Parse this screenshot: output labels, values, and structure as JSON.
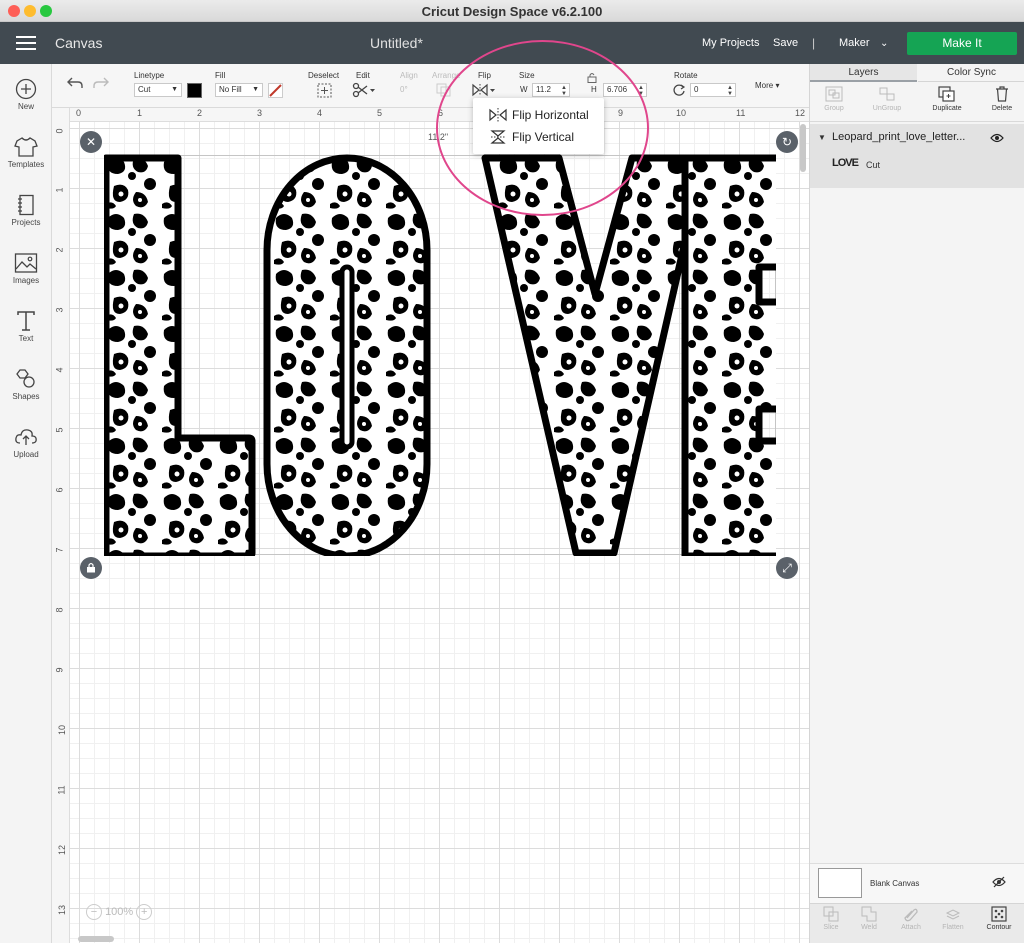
{
  "window": {
    "title": "Cricut Design Space  v6.2.100"
  },
  "header": {
    "section": "Canvas",
    "project_title": "Untitled*",
    "my_projects": "My Projects",
    "save": "Save",
    "separator": "|",
    "machine": "Maker",
    "make_it": "Make It"
  },
  "sidebar": {
    "items": [
      {
        "label": "New",
        "icon": "plus-circle-icon"
      },
      {
        "label": "Templates",
        "icon": "tshirt-icon"
      },
      {
        "label": "Projects",
        "icon": "notebook-icon"
      },
      {
        "label": "Images",
        "icon": "image-icon"
      },
      {
        "label": "Text",
        "icon": "text-t-icon"
      },
      {
        "label": "Shapes",
        "icon": "shapes-icon"
      },
      {
        "label": "Upload",
        "icon": "cloud-upload-icon"
      }
    ]
  },
  "toolbar": {
    "linetype_label": "Linetype",
    "linetype_value": "Cut",
    "fill_label": "Fill",
    "fill_value": "No Fill",
    "fill_color": "#000000",
    "deselect_label": "Deselect",
    "edit_label": "Edit",
    "align_label": "Align",
    "arrange_label": "Arrange",
    "align_value": "0°",
    "flip_label": "Flip",
    "size_label": "Size",
    "w_label": "W",
    "w_value": "11.2",
    "h_label": "H",
    "h_value": "6.706",
    "rotate_label": "Rotate",
    "rotate_value": "0",
    "more_label": "More"
  },
  "flip_menu": {
    "items": [
      "Flip Horizontal",
      "Flip Vertical"
    ]
  },
  "canvas": {
    "ruler_top": [
      "0",
      "1",
      "2",
      "3",
      "4",
      "5",
      "6",
      "7",
      "8",
      "9",
      "10",
      "11",
      "12"
    ],
    "ruler_left": [
      "0",
      "1",
      "2",
      "3",
      "4",
      "5",
      "6",
      "7",
      "8",
      "9",
      "10",
      "11",
      "12",
      "13"
    ],
    "width_readout": "11.2\"",
    "zoom": "100%",
    "design_text": "LOVE"
  },
  "layers_panel": {
    "tabs": [
      "Layers",
      "Color Sync"
    ],
    "tools": [
      {
        "label": "Group",
        "enabled": false
      },
      {
        "label": "UnGroup",
        "enabled": false
      },
      {
        "label": "Duplicate",
        "enabled": true
      },
      {
        "label": "Delete",
        "enabled": true
      }
    ],
    "group_name": "Leopard_print_love_letter...",
    "layer_thumb": "LOVE",
    "layer_operation": "Cut",
    "blank_canvas": "Blank Canvas",
    "bottom_tools": [
      {
        "label": "Slice",
        "enabled": false
      },
      {
        "label": "Weld",
        "enabled": false
      },
      {
        "label": "Attach",
        "enabled": false
      },
      {
        "label": "Flatten",
        "enabled": false
      },
      {
        "label": "Contour",
        "enabled": true
      }
    ]
  },
  "colors": {
    "header_bg": "#414a51",
    "make_it": "#15a454",
    "highlight": "#e0468c"
  }
}
